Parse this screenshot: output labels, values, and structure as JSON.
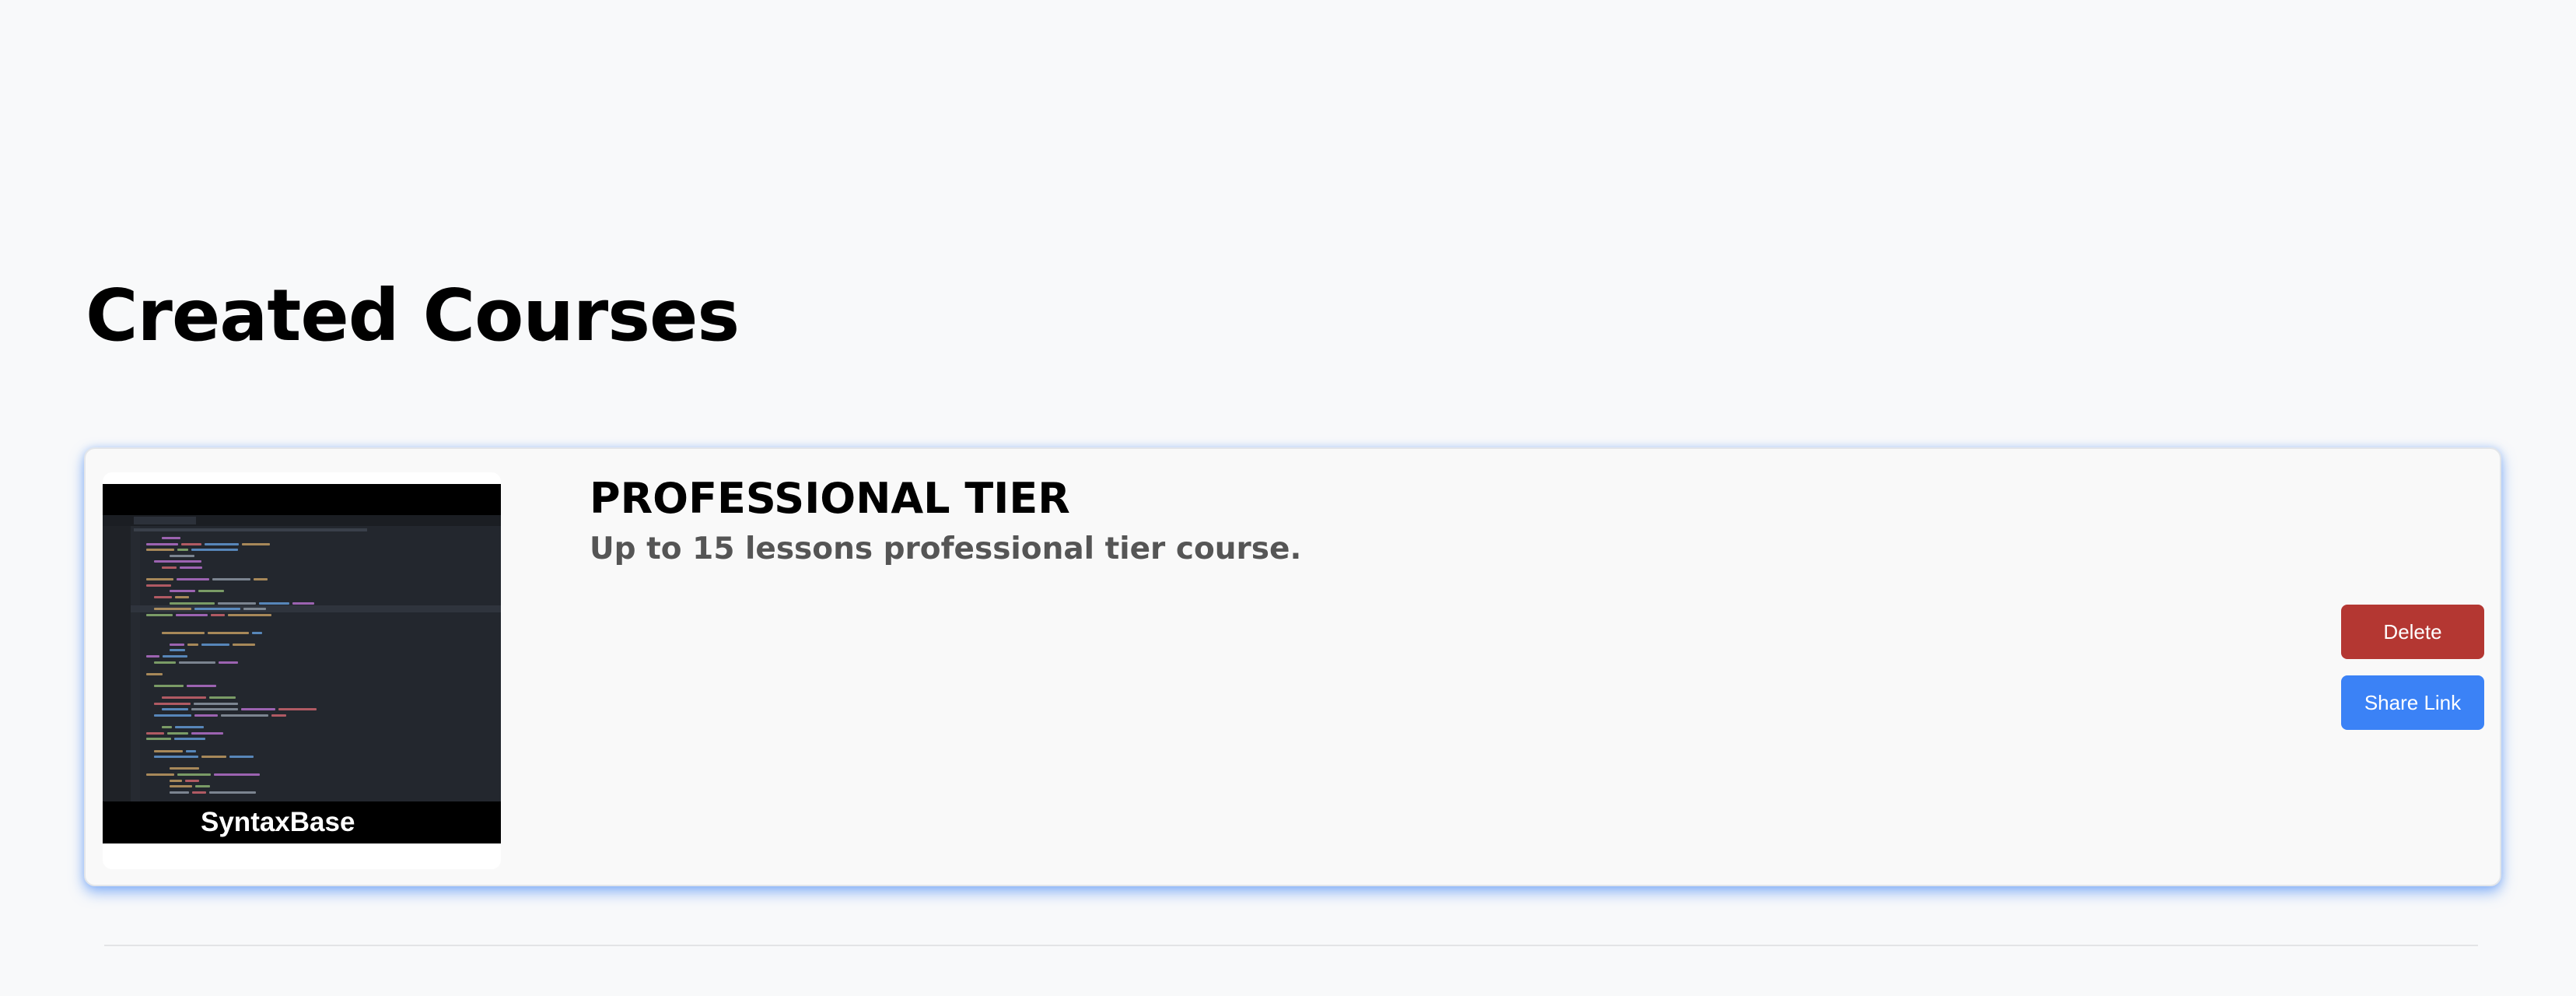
{
  "page": {
    "title": "Created Courses"
  },
  "courses": [
    {
      "thumbnail_caption": "SyntaxBase",
      "title": "PROFESSIONAL TIER",
      "description": "Up to 15 lessons professional tier course.",
      "actions": {
        "delete_label": "Delete",
        "share_label": "Share Link"
      }
    }
  ],
  "colors": {
    "background": "#f8f9fa",
    "delete_button": "#b43732",
    "share_button": "#3b82f6",
    "card_glow": "#3b82f6",
    "description_text": "#555555"
  }
}
